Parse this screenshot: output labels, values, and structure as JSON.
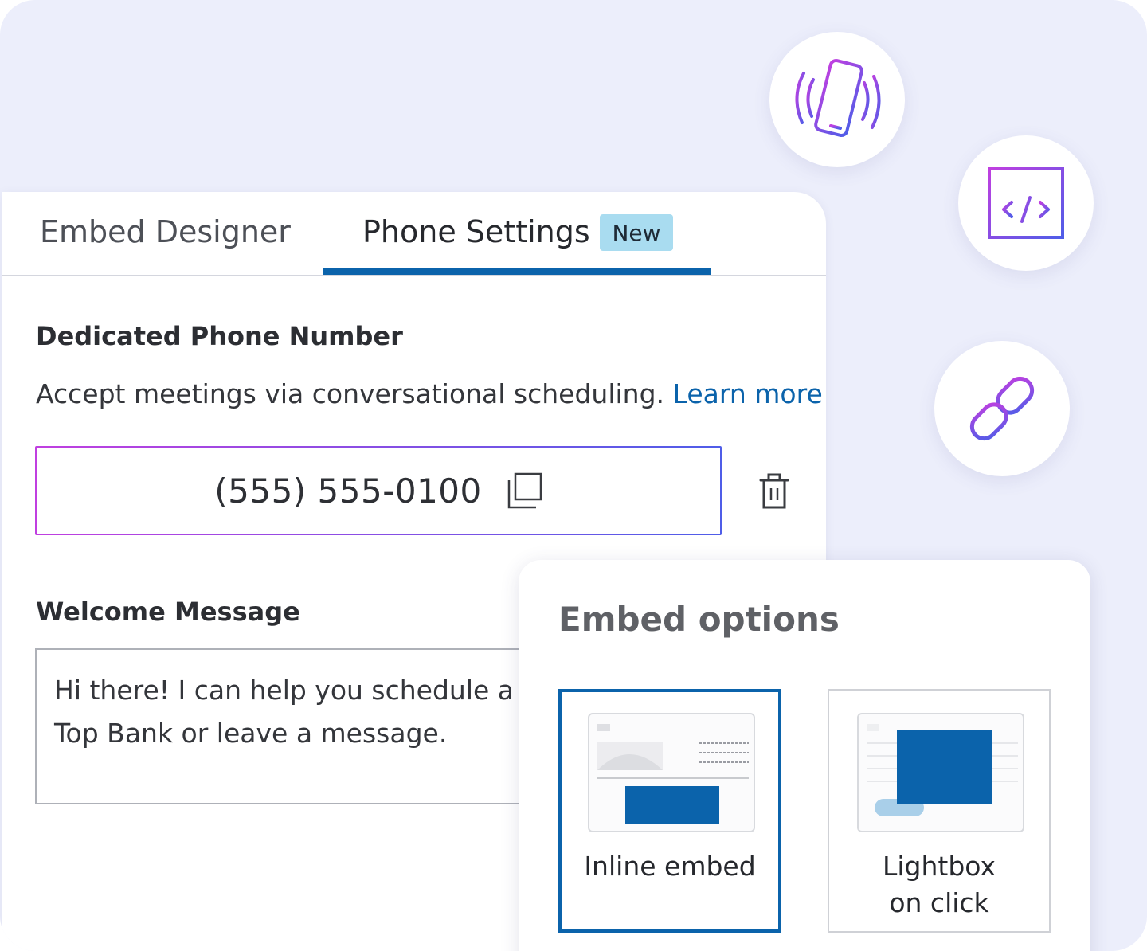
{
  "tabs": {
    "embed_designer": "Embed Designer",
    "phone_settings": "Phone Settings",
    "new_badge": "New"
  },
  "phone_section": {
    "title": "Dedicated Phone Number",
    "description": "Accept meetings via conversational scheduling.",
    "learn_more": "Learn more",
    "number": "(555) 555-0100"
  },
  "welcome_section": {
    "title": "Welcome Message",
    "message": "Hi there! I can help you schedule a m\nTop Bank or leave a message."
  },
  "embed_options": {
    "title": "Embed options",
    "inline_label": "Inline embed",
    "lightbox_label_line1": "Lightbox",
    "lightbox_label_line2": "on click",
    "selected": "Inline embed"
  },
  "icons": [
    "phone-vibrate-icon",
    "embed-code-icon",
    "link-icon",
    "copy-icon",
    "trash-icon"
  ],
  "colors": {
    "accent": "#0b63ab",
    "badge": "#a9dcf0",
    "gradient_start": "#c03fe0",
    "gradient_end": "#4f5de8",
    "background": "#eceefb"
  }
}
